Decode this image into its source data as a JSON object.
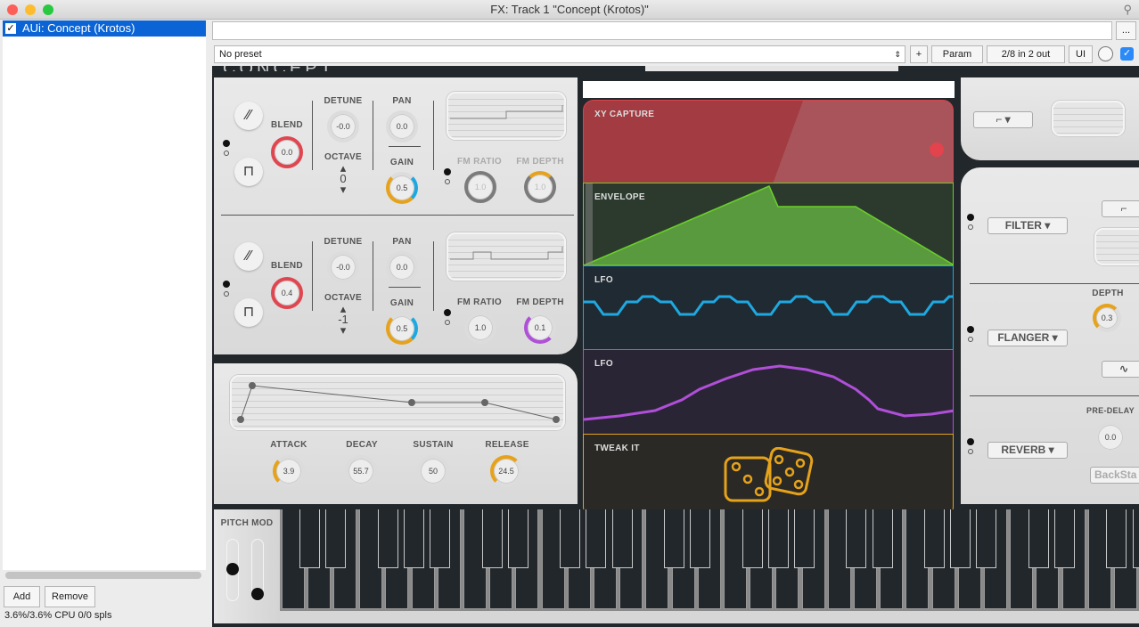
{
  "window": {
    "title": "FX: Track 1 \"Concept (Krotos)\""
  },
  "fx_list": {
    "items": [
      {
        "label": "AUi: Concept (Krotos)",
        "enabled": true
      }
    ],
    "add": "Add",
    "remove": "Remove",
    "cpu": "3.6%/3.6% CPU 0/0 spls"
  },
  "toolbar": {
    "name_value": "",
    "more": "...",
    "preset": "No preset",
    "plus": "+",
    "param": "Param",
    "io": "2/8 in 2 out",
    "ui": "UI",
    "bypass_checked": true
  },
  "osc": [
    {
      "blend_label": "BLEND",
      "blend": "0.0",
      "detune_label": "DETUNE",
      "detune": "-0.0",
      "octave_label": "OCTAVE",
      "octave": "0",
      "pan_label": "PAN",
      "pan": "0.0",
      "gain_label": "GAIN",
      "gain": "0.5",
      "fm_ratio_label": "FM RATIO",
      "fm_ratio": "1.0",
      "fm_depth_label": "FM DEPTH",
      "fm_depth": "1.0"
    },
    {
      "blend_label": "BLEND",
      "blend": "0.4",
      "detune_label": "DETUNE",
      "detune": "-0.0",
      "octave_label": "OCTAVE",
      "octave": "-1",
      "pan_label": "PAN",
      "pan": "0.0",
      "gain_label": "GAIN",
      "gain": "0.5",
      "fm_ratio_label": "FM RATIO",
      "fm_ratio": "1.0",
      "fm_depth_label": "FM DEPTH",
      "fm_depth": "0.1"
    }
  ],
  "adsr": {
    "attack_label": "ATTACK",
    "attack": "3.9",
    "decay_label": "DECAY",
    "decay": "55.7",
    "sustain_label": "SUSTAIN",
    "sustain": "50",
    "release_label": "RELEASE",
    "release": "24.5"
  },
  "modules": {
    "xy": "XY CAPTURE",
    "envelope": "ENVELOPE",
    "lfo1": "LFO",
    "lfo2": "LFO",
    "tweak": "TWEAK IT"
  },
  "colors": {
    "xy": "#a23c42",
    "envelope": "#6ad12a",
    "lfo1": "#1fa8e0",
    "lfo2": "#b04fd8",
    "tweak": "#e6a21a"
  },
  "fx": {
    "filter": "FILTER",
    "flanger": "FLANGER",
    "depth_label": "DEPTH",
    "depth": "0.3",
    "reverb": "REVERB",
    "predelay_label": "PRE-DELAY",
    "predelay": "0.0",
    "backstage": "BackSta"
  },
  "pitch_mod": {
    "label": "PITCH MOD",
    "pitch": 0.5,
    "mod": 0
  }
}
